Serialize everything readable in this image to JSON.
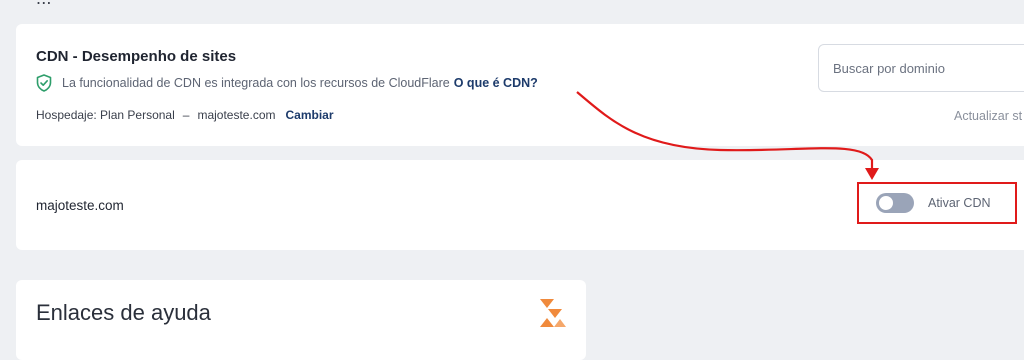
{
  "top_clip_text": "...",
  "header": {
    "title": "CDN - Desempenho de sites",
    "info_text": "La funcionalidad de CDN es integrada con los recursos de CloudFlare",
    "info_link": "O que é CDN?",
    "hosting_label": "Hospedaje: Plan Personal",
    "hosting_separator": "–",
    "hosting_domain": "majoteste.com",
    "change_link": "Cambiar",
    "search_placeholder": "Buscar por dominio",
    "refresh_text": "Actualizar st"
  },
  "domain_row": {
    "domain": "majoteste.com",
    "toggle_label": "Ativar CDN",
    "toggle_on": false
  },
  "help": {
    "title": "Enlaces de ayuda"
  },
  "colors": {
    "background": "#eef0f3",
    "card": "#ffffff",
    "link": "#1d3b6b",
    "annotation_red": "#e01a1a",
    "shield_green": "#2e9e6b",
    "toggle_off": "#9aa4b8",
    "logo_orange": "#f08a3c"
  },
  "icons": {
    "info": "shield-check-icon",
    "brand": "brand-logo-icon"
  }
}
